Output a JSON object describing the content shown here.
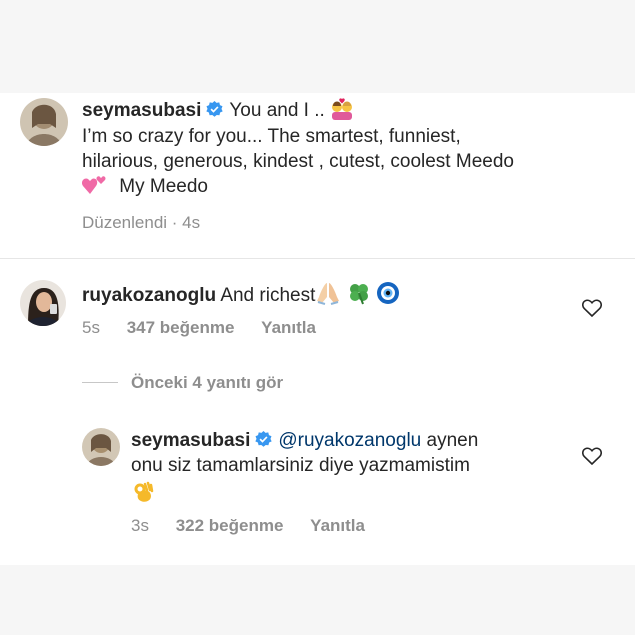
{
  "comment_main": {
    "username": "seymasubasi",
    "line1_text": "You and I ..",
    "line2": "I’m so crazy for you... The smartest, funniest,",
    "line3": "hilarious, generous, kindest , cutest, coolest Meedo",
    "line4_text": "My Meedo",
    "edited_label": "Düzenlendi · 4s",
    "emoji_line1": "couple-with-heart-icon",
    "emoji_line4": "two-hearts-icon"
  },
  "comment_ruya": {
    "username": "ruyakozanoglu",
    "text": "And richest",
    "emojis": [
      "folded-hands-icon",
      "four-leaf-clover-icon",
      "nazar-amulet-icon"
    ],
    "time": "5s",
    "likes": "347 beğenme",
    "reply_label": "Yanıtla"
  },
  "view_replies": "Önceki 4 yanıtı gör",
  "reply": {
    "username": "seymasubasi",
    "mention": "@ruyakozanoglu",
    "text1": "aynen",
    "text2": "onu siz tamamlarsiniz diye yazmamistim",
    "emoji": "ok-hand-icon",
    "time": "3s",
    "likes": "322 beğenme",
    "reply_label": "Yanıtla"
  },
  "colors": {
    "text": "#262626",
    "muted": "#8e8e8e",
    "mention": "#00376b",
    "verified": "#3897f0"
  }
}
